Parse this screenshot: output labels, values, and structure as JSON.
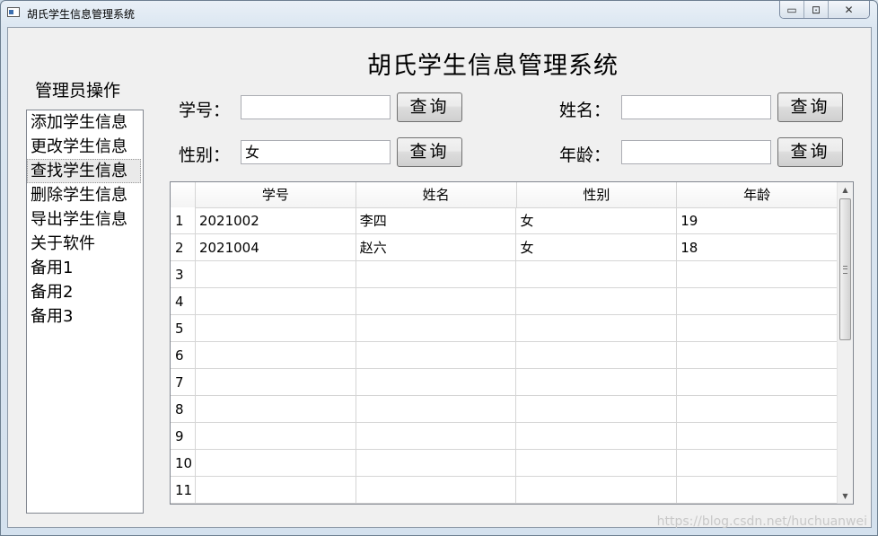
{
  "window": {
    "title": "胡氏学生信息管理系统",
    "controls": {
      "minimize": "▭",
      "maximize": "⊡",
      "close": "✕"
    }
  },
  "header": {
    "title": "胡氏学生信息管理系统"
  },
  "sidebar": {
    "title": "管理员操作",
    "items": [
      {
        "label": "添加学生信息",
        "selected": false
      },
      {
        "label": "更改学生信息",
        "selected": false
      },
      {
        "label": "查找学生信息",
        "selected": true
      },
      {
        "label": "删除学生信息",
        "selected": false
      },
      {
        "label": "导出学生信息",
        "selected": false
      },
      {
        "label": "关于软件",
        "selected": false
      },
      {
        "label": "备用1",
        "selected": false
      },
      {
        "label": "备用2",
        "selected": false
      },
      {
        "label": "备用3",
        "selected": false
      }
    ]
  },
  "search": {
    "id_label": "学号：",
    "id_value": "",
    "name_label": "姓名：",
    "name_value": "",
    "gender_label": "性别：",
    "gender_value": "女",
    "age_label": "年龄：",
    "age_value": "",
    "query_label": "查询"
  },
  "table": {
    "columns": [
      "学号",
      "姓名",
      "性别",
      "年龄"
    ],
    "row_numbers": [
      "1",
      "2",
      "3",
      "4",
      "5",
      "6",
      "7",
      "8",
      "9",
      "10",
      "11"
    ],
    "rows": [
      [
        "2021002",
        "李四",
        "女",
        "19"
      ],
      [
        "2021004",
        "赵六",
        "女",
        "18"
      ],
      [
        "",
        "",
        "",
        ""
      ],
      [
        "",
        "",
        "",
        ""
      ],
      [
        "",
        "",
        "",
        ""
      ],
      [
        "",
        "",
        "",
        ""
      ],
      [
        "",
        "",
        "",
        ""
      ],
      [
        "",
        "",
        "",
        ""
      ],
      [
        "",
        "",
        "",
        ""
      ],
      [
        "",
        "",
        "",
        ""
      ],
      [
        "",
        "",
        "",
        ""
      ]
    ]
  },
  "watermark": "https://blog.csdn.net/huchuanwei"
}
